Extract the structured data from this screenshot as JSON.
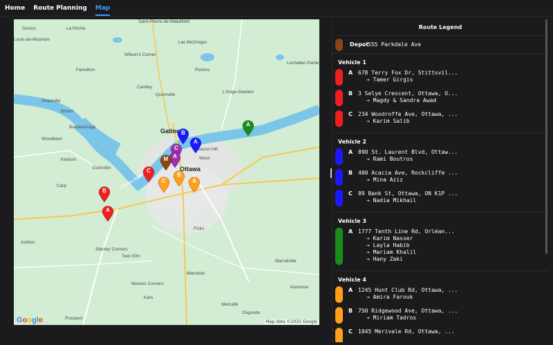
{
  "nav": {
    "tabs": [
      {
        "label": "Home",
        "active": false
      },
      {
        "label": "Route Planning",
        "active": false
      },
      {
        "label": "Map",
        "active": true
      }
    ]
  },
  "map": {
    "attribution": "Map data ©2025 Google",
    "logo": "Google",
    "labels": {
      "ducloslac": "Duclos",
      "lapeche": "La Pêche",
      "saintpierre": "Saint-Pierre-de-Wakefield",
      "louisdemasham": "Louis-de-Masham",
      "lesollets": "Les Collines-de-l'Outaouais",
      "lacrogers": "Lac-McGregor",
      "noyan": "Val-des-Bois",
      "wilsons": "Wilson's Corner",
      "farrellton": "Farrellton",
      "perkins": "Perkins",
      "cantley": "Cantley",
      "quinnville": "Quinnville",
      "lange": "L'Ange-Gardien",
      "lochaber": "Lochaber-Partie",
      "shawville": "Shawville",
      "bristol": "Bristol",
      "breckenridge": "Breckenridge",
      "gatineau": "Gatineau",
      "beacon": "Beacon Hill",
      "ward": "Ward",
      "ottawa": "Ottawa",
      "woodlawn": "Woodlawn",
      "kinburn": "Kinburn",
      "dunrobin": "Dunrobin",
      "ottawariver": "Ottawa River",
      "carp": "Carp",
      "stanley": "Stanley Corners",
      "twinelm": "Twin Elm",
      "ficko": "Ficko",
      "marvelville": "Marvelville",
      "manotick": "Manotick",
      "kars": "Kars",
      "metcalfe": "Metcalfe",
      "osgoode": "Osgoode",
      "prospect": "Prospect",
      "kenmore": "Kenmore",
      "moorescorners": "Moores Corners",
      "ashton": "Ashton"
    },
    "pins": [
      {
        "letter": "A",
        "color": "#1a8c1a",
        "name": "pin-vehicle3-a"
      },
      {
        "letter": "B",
        "color": "#1a1aff",
        "name": "pin-vehicle2-b"
      },
      {
        "letter": "A",
        "color": "#1a1aff",
        "name": "pin-vehicle2-a"
      },
      {
        "letter": "C",
        "color": "#9b2fae",
        "name": "pin-vehicle2-c"
      },
      {
        "letter": "A",
        "color": "#9b2fae",
        "name": "pin-vehicle-purple-a"
      },
      {
        "letter": "M",
        "color": "#8b4513",
        "name": "pin-depot"
      },
      {
        "letter": "C",
        "color": "#f01f1f",
        "name": "pin-vehicle1-c"
      },
      {
        "letter": "B",
        "color": "#ff9f1a",
        "name": "pin-vehicle4-b"
      },
      {
        "letter": "C",
        "color": "#ff9f1a",
        "name": "pin-vehicle4-c"
      },
      {
        "letter": "A",
        "color": "#ff9f1a",
        "name": "pin-vehicle4-a"
      },
      {
        "letter": "B",
        "color": "#f01f1f",
        "name": "pin-vehicle1-b"
      },
      {
        "letter": "A",
        "color": "#f01f1f",
        "name": "pin-vehicle1-a"
      }
    ]
  },
  "legend": {
    "title": "Route Legend",
    "depot": {
      "label": "Depot",
      "address": "555 Parkdale Ave",
      "color": "#8b4513"
    },
    "vehicles": [
      {
        "name": "Vehicle 1",
        "color": "#f01f1f",
        "stops": [
          {
            "letter": "A",
            "address": "678 Terry Fox Dr, Stittsvil...",
            "people": "→ Tamer Girgis"
          },
          {
            "letter": "B",
            "address": "3 Selye Crescent, Ottawa, O...",
            "people": "→ Magdy & Sandra Awad"
          },
          {
            "letter": "C",
            "address": "234 Woodroffe Ave, Ottawa, ...",
            "people": "→ Karim Salib"
          }
        ]
      },
      {
        "name": "Vehicle 2",
        "color": "#1a1aff",
        "stops": [
          {
            "letter": "A",
            "address": "890 St. Laurent Blvd, Ottaw...",
            "people": "→ Rami Boutros"
          },
          {
            "letter": "B",
            "address": "400 Acacia Ave, Rockcliffe ...",
            "people": "→ Mina Aziz"
          },
          {
            "letter": "C",
            "address": "89 Bank St, Ottawa, ON K1P ...",
            "people": "→ Nadia Mikhail"
          }
        ]
      },
      {
        "name": "Vehicle 3",
        "color": "#1a8c1a",
        "stops": [
          {
            "letter": "A",
            "address": "1777 Tenth Line Rd, Orléan...",
            "people": "→ Karim Nasser\n→ Layla Habib\n→ Mariam Khalil\n→ Hany Zaki"
          }
        ]
      },
      {
        "name": "Vehicle 4",
        "color": "#ff9f1a",
        "stops": [
          {
            "letter": "A",
            "address": "1245 Hunt Club Rd, Ottawa, ...",
            "people": "→ Amira Farouk"
          },
          {
            "letter": "B",
            "address": "750 Ridgewood Ave, Ottawa, ...",
            "people": "→ Miriam Tadros"
          },
          {
            "letter": "C",
            "address": "1045 Merivale Rd, Ottawa, ...",
            "people": ""
          }
        ]
      }
    ]
  }
}
